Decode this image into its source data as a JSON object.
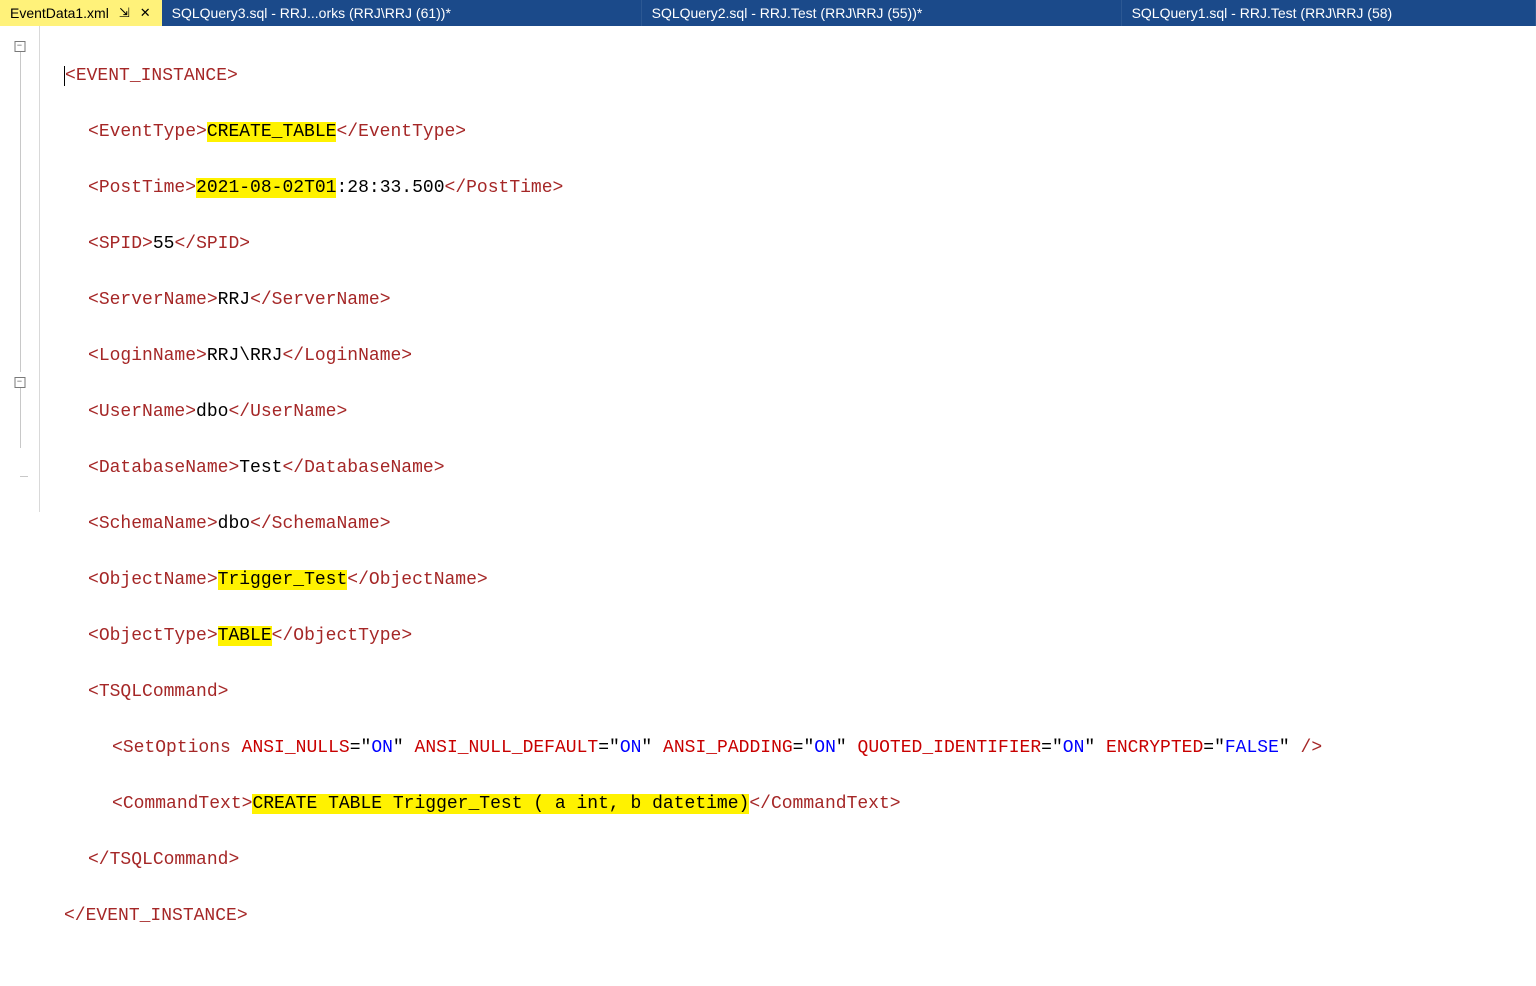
{
  "tabs": [
    {
      "label": "EventData1.xml",
      "active": true,
      "pin": "⇲",
      "close": "✕"
    },
    {
      "label": "SQLQuery3.sql - RRJ...orks (RRJ\\RRJ (61))*"
    },
    {
      "label": "SQLQuery2.sql - RRJ.Test (RRJ\\RRJ (55))*"
    },
    {
      "label": "SQLQuery1.sql - RRJ.Test (RRJ\\RRJ (58)"
    }
  ],
  "fold": {
    "glyph1": "−",
    "glyph2": "−"
  },
  "xml": {
    "root_open": "EVENT_INSTANCE",
    "root_close": "EVENT_INSTANCE",
    "event_type_tag": "EventType",
    "event_type_val": "CREATE_TABLE",
    "post_time_tag": "PostTime",
    "post_time_hl": "2021-08-02T01",
    "post_time_rest": ":28:33.500",
    "spid_tag": "SPID",
    "spid_val": "55",
    "server_tag": "ServerName",
    "server_val": "RRJ",
    "login_tag": "LoginName",
    "login_val": "RRJ\\RRJ",
    "user_tag": "UserName",
    "user_val": "dbo",
    "db_tag": "DatabaseName",
    "db_val": "Test",
    "schema_tag": "SchemaName",
    "schema_val": "dbo",
    "obj_tag": "ObjectName",
    "obj_val": "Trigger_Test",
    "objtype_tag": "ObjectType",
    "objtype_val": "TABLE",
    "tsql_open": "TSQLCommand",
    "tsql_close": "TSQLCommand",
    "setopts_tag": "SetOptions",
    "setopts_attrs": [
      {
        "n": "ANSI_NULLS",
        "v": "ON"
      },
      {
        "n": "ANSI_NULL_DEFAULT",
        "v": "ON"
      },
      {
        "n": "ANSI_PADDING",
        "v": "ON"
      },
      {
        "n": "QUOTED_IDENTIFIER",
        "v": "ON"
      },
      {
        "n": "ENCRYPTED",
        "v": "FALSE"
      }
    ],
    "cmd_tag": "CommandText",
    "cmd_hl": "CREATE TABLE Trigger_Test ( a int, b datetime)"
  }
}
